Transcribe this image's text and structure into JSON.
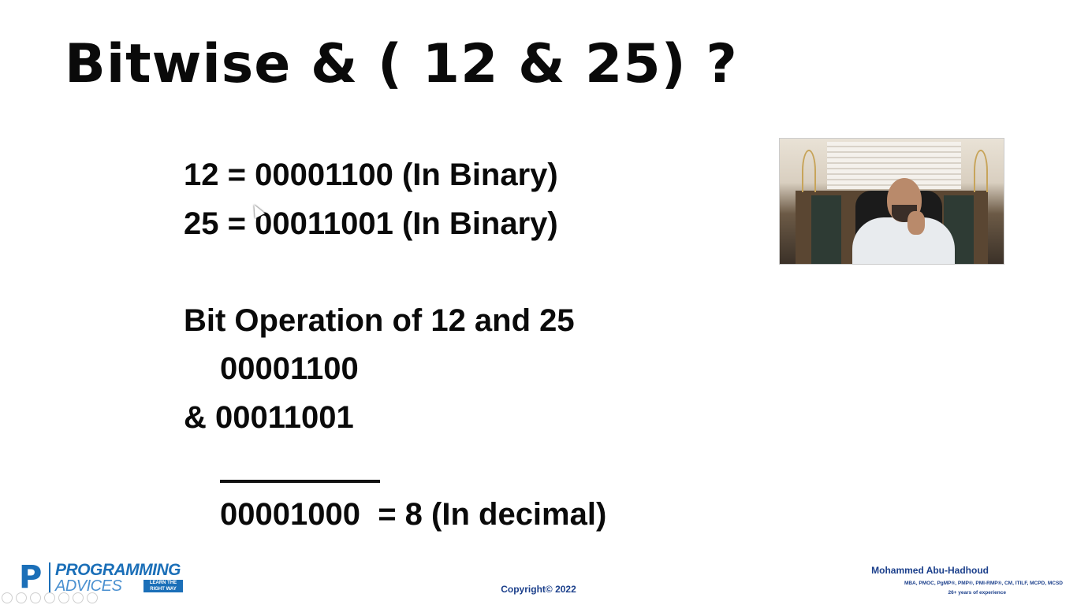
{
  "slide": {
    "title": "Bitwise & ( 12 & 25) ?",
    "lines": [
      "12 = 00001100 (In Binary)",
      "25 = 00011001 (In Binary)",
      "Bit Operation of 12 and 25",
      "00001100",
      "& 00011001",
      "00001000  = 8 (In decimal)"
    ]
  },
  "footer": {
    "logo_letter": "P",
    "logo_top": "PROGRAMMING",
    "logo_bottom": "ADVICES",
    "logo_tagline": "LEARN THE\nRIGHT WAY",
    "copyright": "Copyright© 2022",
    "author_name": "Mohammed Abu-Hadhoud",
    "author_credentials": "MBA, PMOC, PgMP®, PMP®, PMI-RMP®, CM, ITILF, MCPD, MCSD",
    "author_experience": "26+ years of experience"
  },
  "icons": [
    "cursor-arrow-icon",
    "player-control-icon"
  ]
}
